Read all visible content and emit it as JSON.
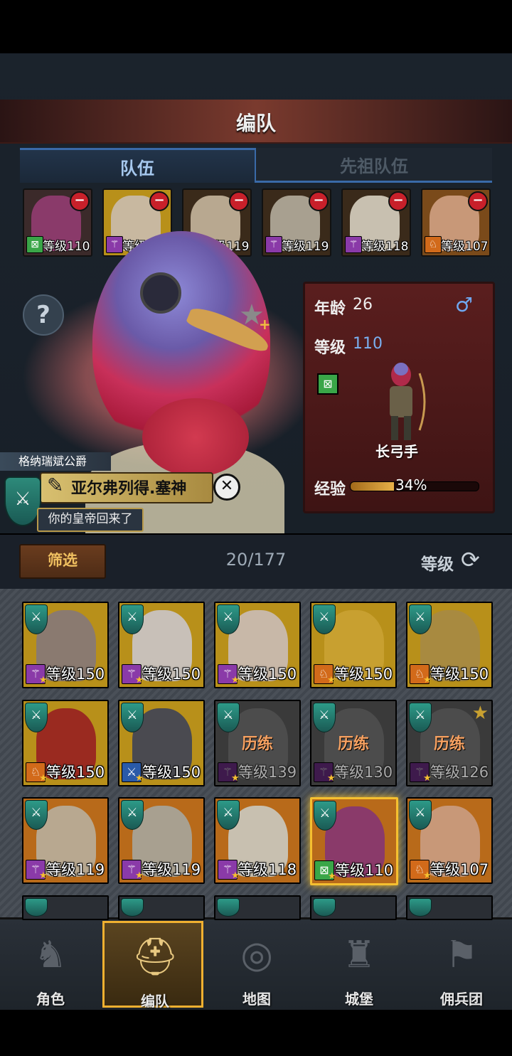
{
  "header": {
    "title": "编队"
  },
  "tabs": [
    {
      "label": "队伍"
    },
    {
      "label": "先祖队伍"
    }
  ],
  "team_portraits": [
    {
      "level_text": "等级110",
      "class": "bow",
      "class_color": "#3aa648",
      "face_color": "#8a3a6a",
      "bg": "#3b2a2a",
      "badge": true
    },
    {
      "level_text": "等级150",
      "class": "staff",
      "class_color": "#8a3aa8",
      "face_color": "#c8b8a0",
      "bg": "#b8901a",
      "badge": false
    },
    {
      "level_text": "等级119",
      "class": "staff",
      "class_color": "#8a3aa8",
      "face_color": "#b8a890",
      "bg": "#3a2a1a",
      "badge": false
    },
    {
      "level_text": "等级119",
      "class": "staff",
      "class_color": "#8a3aa8",
      "face_color": "#a8a090",
      "bg": "#3a2a1a",
      "badge": false
    },
    {
      "level_text": "等级118",
      "class": "staff",
      "class_color": "#8a3aa8",
      "face_color": "#c8c0b0",
      "bg": "#3a2a1a",
      "badge": false
    },
    {
      "level_text": "等级107",
      "class": "mount",
      "class_color": "#d26a1a",
      "face_color": "#c89878",
      "bg": "#7a4a1a",
      "badge": false
    }
  ],
  "hero": {
    "owner_title": "格纳瑞斌公爵",
    "name": "亚尔弗列得.塞神",
    "slogan": "你的皇帝回来了",
    "age_label": "年龄",
    "age": "26",
    "gender_icon": "♂",
    "level_label": "等级",
    "level": "110",
    "class_name": "长弓手",
    "exp_label": "经验",
    "exp_text": "34%",
    "exp_fraction": 0.34
  },
  "filter": {
    "button_label": "筛选",
    "count": "20/177",
    "sort_label": "等级"
  },
  "roster": [
    {
      "level_text": "等级150",
      "class": "staff",
      "class_color": "#8a3aa8",
      "bg": "#b8901a",
      "face": "#8a7a70",
      "dim": false
    },
    {
      "level_text": "等级150",
      "class": "staff",
      "class_color": "#8a3aa8",
      "bg": "#b8901a",
      "face": "#c8c0b8",
      "dim": false
    },
    {
      "level_text": "等级150",
      "class": "staff",
      "class_color": "#8a3aa8",
      "bg": "#b8901a",
      "face": "#c8b8a8",
      "dim": false
    },
    {
      "level_text": "等级150",
      "class": "mount",
      "class_color": "#d26a1a",
      "bg": "#b8901a",
      "face": "#c8a030",
      "dim": false
    },
    {
      "level_text": "等级150",
      "class": "mount",
      "class_color": "#d26a1a",
      "bg": "#b8901a",
      "face": "#a88a40",
      "dim": false
    },
    {
      "level_text": "等级150",
      "class": "mount",
      "class_color": "#d26a1a",
      "bg": "#b8901a",
      "face": "#9a2a20",
      "dim": false
    },
    {
      "level_text": "等级150",
      "class": "sword",
      "class_color": "#2a5aa8",
      "bg": "#b8901a",
      "face": "#4a4a50",
      "dim": false
    },
    {
      "level_text": "等级139",
      "class": "staff",
      "class_color": "#8a3aa8",
      "bg": "#3a3a3a",
      "face": "#a8a8a8",
      "dim": true,
      "overlay": "历练"
    },
    {
      "level_text": "等级130",
      "class": "staff",
      "class_color": "#8a3aa8",
      "bg": "#3a3a3a",
      "face": "#a8a8a8",
      "dim": true,
      "overlay": "历练"
    },
    {
      "level_text": "等级126",
      "class": "staff",
      "class_color": "#8a3aa8",
      "bg": "#3a3a3a",
      "face": "#a8a8a8",
      "dim": true,
      "overlay": "历练",
      "star": true
    },
    {
      "level_text": "等级119",
      "class": "staff",
      "class_color": "#8a3aa8",
      "bg": "#b86a1a",
      "face": "#b8a890",
      "dim": false
    },
    {
      "level_text": "等级119",
      "class": "staff",
      "class_color": "#8a3aa8",
      "bg": "#b86a1a",
      "face": "#a8a090",
      "dim": false
    },
    {
      "level_text": "等级118",
      "class": "staff",
      "class_color": "#8a3aa8",
      "bg": "#b86a1a",
      "face": "#c8c0b0",
      "dim": false
    },
    {
      "level_text": "等级110",
      "class": "bow",
      "class_color": "#3aa648",
      "bg": "#b86a1a",
      "face": "#8a3a6a",
      "dim": false,
      "selected": true
    },
    {
      "level_text": "等级107",
      "class": "mount",
      "class_color": "#d26a1a",
      "bg": "#b86a1a",
      "face": "#c89878",
      "dim": false
    }
  ],
  "nav": [
    {
      "label": "角色",
      "icon": "knight-icon"
    },
    {
      "label": "编队",
      "icon": "helmet-icon",
      "active": true
    },
    {
      "label": "地图",
      "icon": "compass-icon"
    },
    {
      "label": "城堡",
      "icon": "castle-icon"
    },
    {
      "label": "佣兵团",
      "icon": "mercenary-icon"
    }
  ]
}
